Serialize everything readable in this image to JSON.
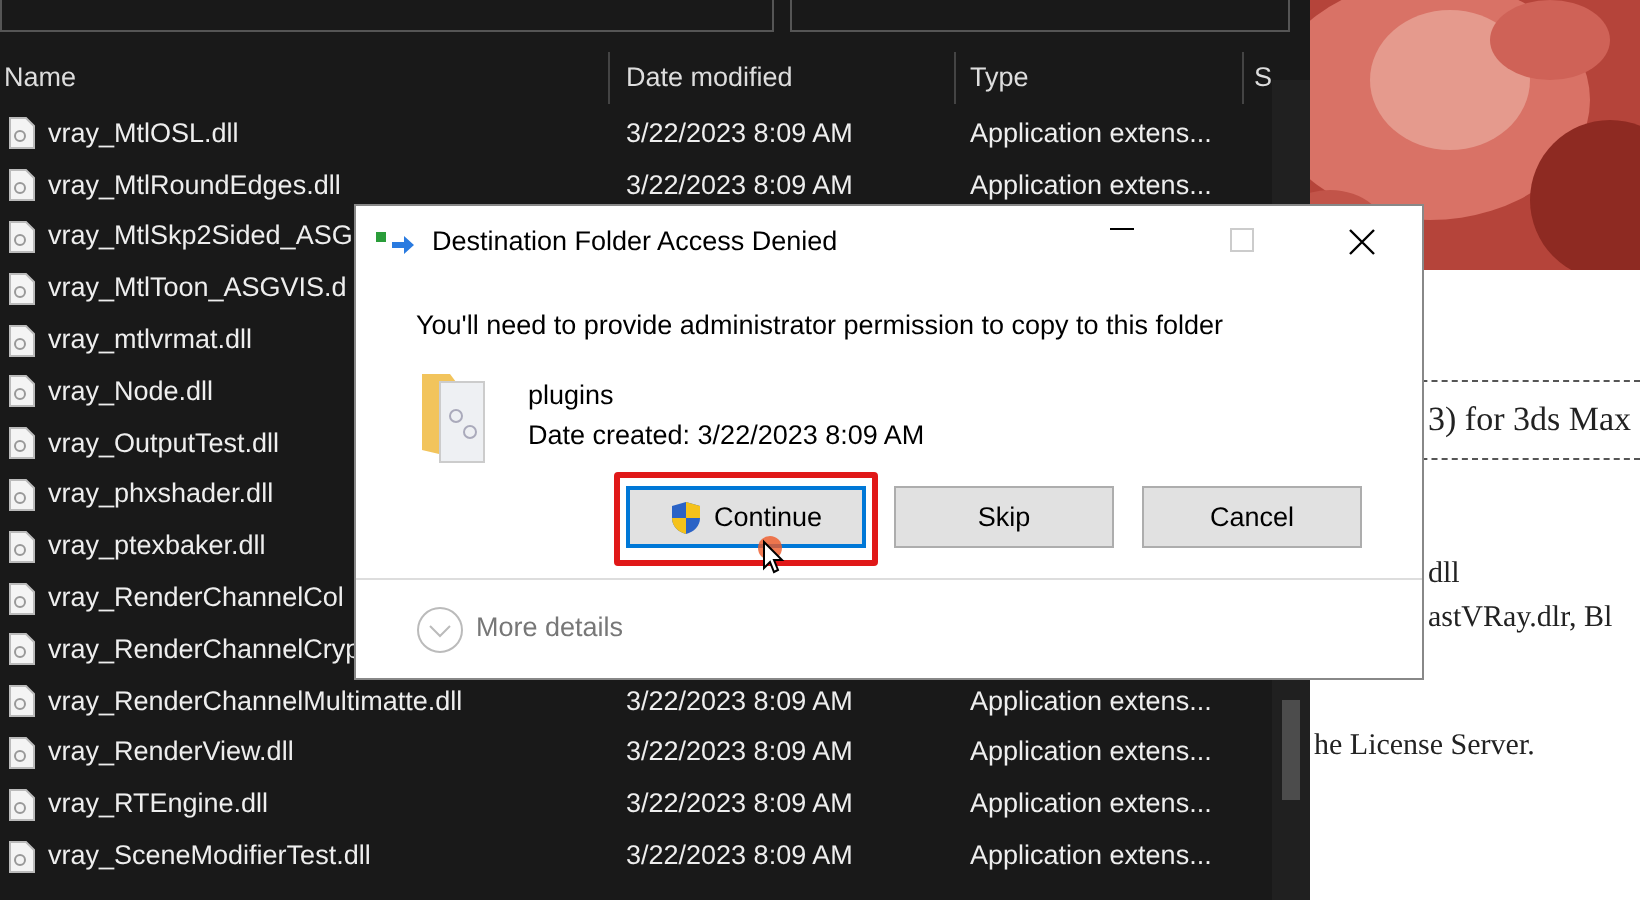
{
  "explorer": {
    "columns": [
      {
        "label": "Name"
      },
      {
        "label": "Date modified"
      },
      {
        "label": "Type"
      },
      {
        "label": "S"
      }
    ],
    "rows": [
      {
        "name": "vray_MtlOSL.dll",
        "date": "3/22/2023 8:09 AM",
        "type": "Application extens..."
      },
      {
        "name": "vray_MtlRoundEdges.dll",
        "date": "3/22/2023 8:09 AM",
        "type": "Application extens..."
      },
      {
        "name": "vray_MtlSkp2Sided_ASG"
      },
      {
        "name": "vray_MtlToon_ASGVIS.d"
      },
      {
        "name": "vray_mtlvrmat.dll"
      },
      {
        "name": "vray_Node.dll"
      },
      {
        "name": "vray_OutputTest.dll"
      },
      {
        "name": "vray_phxshader.dll"
      },
      {
        "name": "vray_ptexbaker.dll"
      },
      {
        "name": "vray_RenderChannelCol"
      },
      {
        "name": "vray_RenderChannelCryp"
      },
      {
        "name": "vray_RenderChannelMultimatte.dll",
        "date": "3/22/2023 8:09 AM",
        "type": "Application extens..."
      },
      {
        "name": "vray_RenderView.dll",
        "date": "3/22/2023 8:09 AM",
        "type": "Application extens..."
      },
      {
        "name": "vray_RTEngine.dll",
        "date": "3/22/2023 8:09 AM",
        "type": "Application extens..."
      },
      {
        "name": "vray_SceneModifierTest.dll",
        "date": "3/22/2023 8:09 AM",
        "type": "Application extens..."
      }
    ]
  },
  "document": {
    "lines": [
      {
        "text": "3) for 3ds Max",
        "kind": "heading"
      },
      {
        "text": "dll",
        "kind": "body"
      },
      {
        "text": "astVRay.dlr, Bl",
        "kind": "body"
      },
      {
        "text": "he License Server.",
        "kind": "wide"
      }
    ]
  },
  "dialog": {
    "title": "Destination Folder Access Denied",
    "message": "You'll need to provide administrator permission to copy to this folder",
    "item": {
      "name": "plugins",
      "detail": "Date created: 3/22/2023 8:09 AM"
    },
    "buttons": [
      {
        "label": "Continue",
        "kind": "elevated",
        "highlighted": true
      },
      {
        "label": "Skip",
        "kind": "plain",
        "highlighted": false
      },
      {
        "label": "Cancel",
        "kind": "plain",
        "highlighted": false
      }
    ],
    "more_details": "More details"
  }
}
